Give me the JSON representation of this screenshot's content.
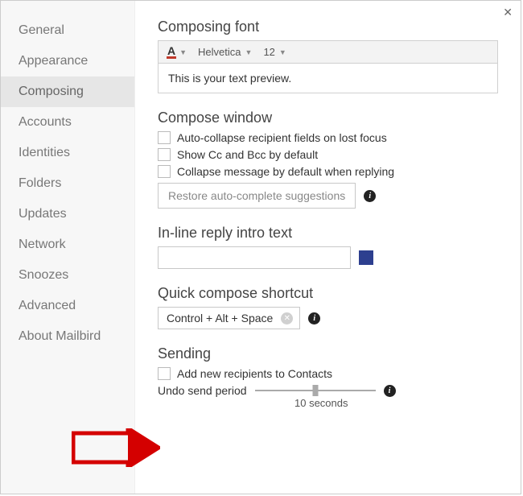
{
  "sidebar": {
    "items": [
      {
        "label": "General"
      },
      {
        "label": "Appearance"
      },
      {
        "label": "Composing",
        "selected": true
      },
      {
        "label": "Accounts"
      },
      {
        "label": "Identities"
      },
      {
        "label": "Folders"
      },
      {
        "label": "Updates"
      },
      {
        "label": "Network"
      },
      {
        "label": "Snoozes"
      },
      {
        "label": "Advanced"
      },
      {
        "label": "About Mailbird"
      }
    ]
  },
  "composing_font": {
    "title": "Composing font",
    "color_glyph": "A",
    "font_name": "Helvetica",
    "font_size": "12",
    "preview_text": "This is your text preview."
  },
  "compose_window": {
    "title": "Compose window",
    "opts": [
      "Auto-collapse recipient fields on lost focus",
      "Show Cc and Bcc by default",
      "Collapse message by default when replying"
    ],
    "restore_btn": "Restore auto-complete suggestions"
  },
  "inline_reply": {
    "title": "In-line reply intro text",
    "value": ""
  },
  "quick_compose": {
    "title": "Quick compose shortcut",
    "shortcut": "Control + Alt + Space"
  },
  "sending": {
    "title": "Sending",
    "add_recipients": "Add new recipients to Contacts",
    "undo_label": "Undo send period",
    "undo_value": "10 seconds"
  }
}
